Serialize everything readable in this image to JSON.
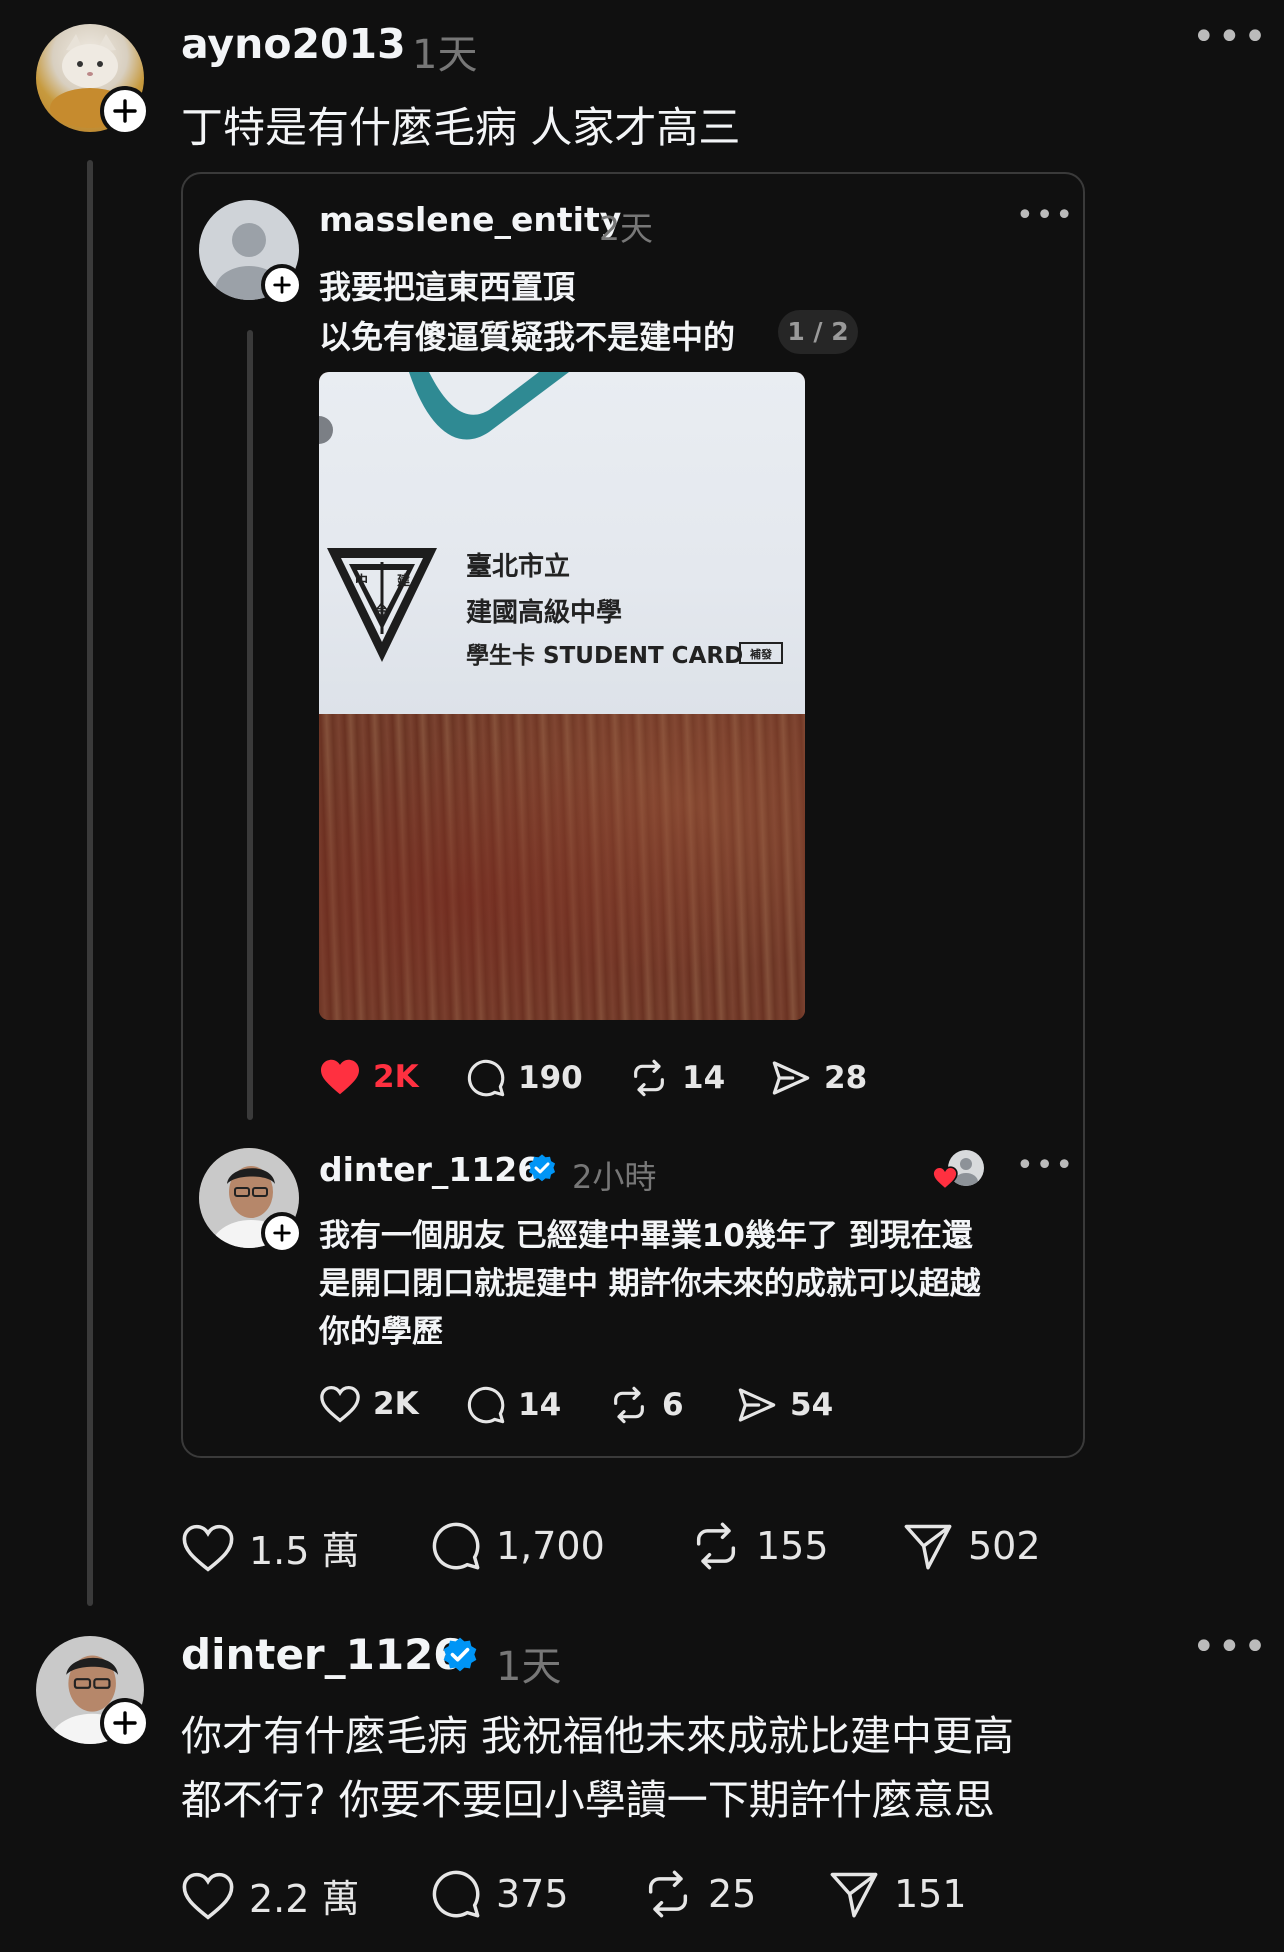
{
  "colors": {
    "background": "#101010",
    "text": "#f3f5f7",
    "muted": "#777777",
    "like_red": "#ff3040",
    "verified_blue": "#0095f6",
    "border": "#3a3a3a"
  },
  "post_top": {
    "username": "ayno2013",
    "time": "1天",
    "text": "丁特是有什麼毛病 人家才高三",
    "more_icon": "more-icon",
    "actions": {
      "likes": "1.5 萬",
      "comments": "1,700",
      "reposts": "155",
      "shares": "502"
    }
  },
  "quoted": {
    "post": {
      "username": "masslene_entity",
      "time": "2天",
      "text_line1": "我要把這東西置頂",
      "text_line2": "以免有傻逼質疑我不是建中的",
      "page_indicator": "1 / 2",
      "photo": {
        "card_line1": "臺北市立",
        "card_line2": "建國高級中學",
        "card_line3": "學生卡 STUDENT CARD",
        "card_tag": "補發",
        "logo_text_left": "中",
        "logo_text_right": "建",
        "logo_text_bottom": "台"
      },
      "actions": {
        "likes": "2K",
        "liked": true,
        "comments": "190",
        "reposts": "14",
        "shares": "28"
      }
    },
    "reply": {
      "username": "dinter_1126",
      "verified": true,
      "time": "2小時",
      "text_line1": "我有一個朋友 已經建中畢業10幾年了 到現在還",
      "text_line2": "是開口閉口就提建中 期許你未來的成就可以超越",
      "text_line3": "你的學歷",
      "actions": {
        "likes": "2K",
        "comments": "14",
        "reposts": "6",
        "shares": "54"
      }
    }
  },
  "post_bottom": {
    "username": "dinter_1126",
    "verified": true,
    "time": "1天",
    "text_line1": "你才有什麼毛病 我祝福他未來成就比建中更高",
    "text_line2": "都不行? 你要不要回小學讀一下期許什麼意思",
    "actions": {
      "likes": "2.2 萬",
      "comments": "375",
      "reposts": "25",
      "shares": "151"
    }
  }
}
